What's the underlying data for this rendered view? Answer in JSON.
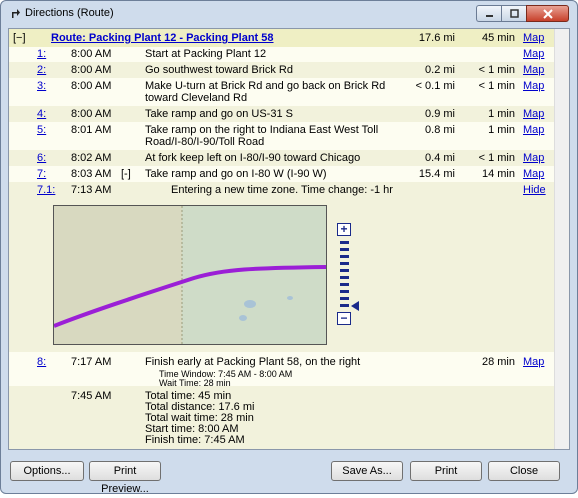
{
  "window": {
    "title": "Directions (Route)"
  },
  "route": {
    "toggle": "[−]",
    "name": "Route: Packing Plant 12 - Packing Plant 58",
    "distance": "17.6 mi",
    "time": "45 min",
    "map_link": "Map"
  },
  "steps": [
    {
      "num": "1:",
      "time": "8:00 AM",
      "desc": [
        "Start at Packing Plant 12"
      ],
      "dist": "",
      "dur": "",
      "link": "Map"
    },
    {
      "num": "2:",
      "time": "8:00 AM",
      "desc": [
        "Go southwest toward Brick Rd"
      ],
      "dist": "0.2 mi",
      "dur": "< 1 min",
      "link": "Map"
    },
    {
      "num": "3:",
      "time": "8:00 AM",
      "desc": [
        "Make U-turn at Brick Rd and go back on Brick Rd",
        "toward Cleveland Rd"
      ],
      "dist": "< 0.1 mi",
      "dur": "< 1 min",
      "link": "Map"
    },
    {
      "num": "4:",
      "time": "8:00 AM",
      "desc": [
        "Take ramp and go on US-31 S"
      ],
      "dist": "0.9 mi",
      "dur": "1 min",
      "link": "Map"
    },
    {
      "num": "5:",
      "time": "8:01 AM",
      "desc": [
        "Take ramp on the right to Indiana East West Toll",
        "Road/I-80/I-90/Toll Road"
      ],
      "dist": "0.8 mi",
      "dur": "1 min",
      "link": "Map"
    },
    {
      "num": "6:",
      "time": "8:02 AM",
      "desc": [
        "At fork keep left on I-80/I-90 toward Chicago"
      ],
      "dist": "0.4 mi",
      "dur": "< 1 min",
      "link": "Map"
    },
    {
      "num": "7:",
      "time": "8:03 AM",
      "toggle": "[-]",
      "desc": [
        "Take ramp and go on I-80 W (I-90 W)"
      ],
      "dist": "15.4 mi",
      "dur": "14 min",
      "link": "Map"
    },
    {
      "num": "7.1:",
      "time": "7:13 AM",
      "desc": [
        "Entering a new time zone. Time change: -1 hr"
      ],
      "dist": "",
      "dur": "",
      "link": "Hide"
    },
    {
      "num": "8:",
      "time": "7:17 AM",
      "desc": [
        "Finish early at Packing Plant 58, on the right"
      ],
      "dist": "",
      "dur": "28 min",
      "link": "Map"
    }
  ],
  "finish_details": {
    "time_window": "Time Window: 7:45 AM - 8:00 AM",
    "wait_time": "Wait Time: 28 min"
  },
  "summary": {
    "time": "7:45 AM",
    "lines": [
      "Total time: 45 min",
      "Total distance: 17.6 mi",
      "Total wait time: 28 min",
      "Start time: 8:00 AM",
      "Finish time: 7:45 AM"
    ]
  },
  "map": {
    "zoom_in": "+",
    "zoom_out": "−",
    "colors": {
      "route": "#9b1fd6",
      "land_left": "#d8d9c0",
      "land_right": "#cfdcc8",
      "water": "#a9c3d6"
    }
  },
  "buttons": {
    "options": "Options...",
    "print_preview": "Print Preview...",
    "save_as": "Save As...",
    "print": "Print",
    "close": "Close"
  }
}
